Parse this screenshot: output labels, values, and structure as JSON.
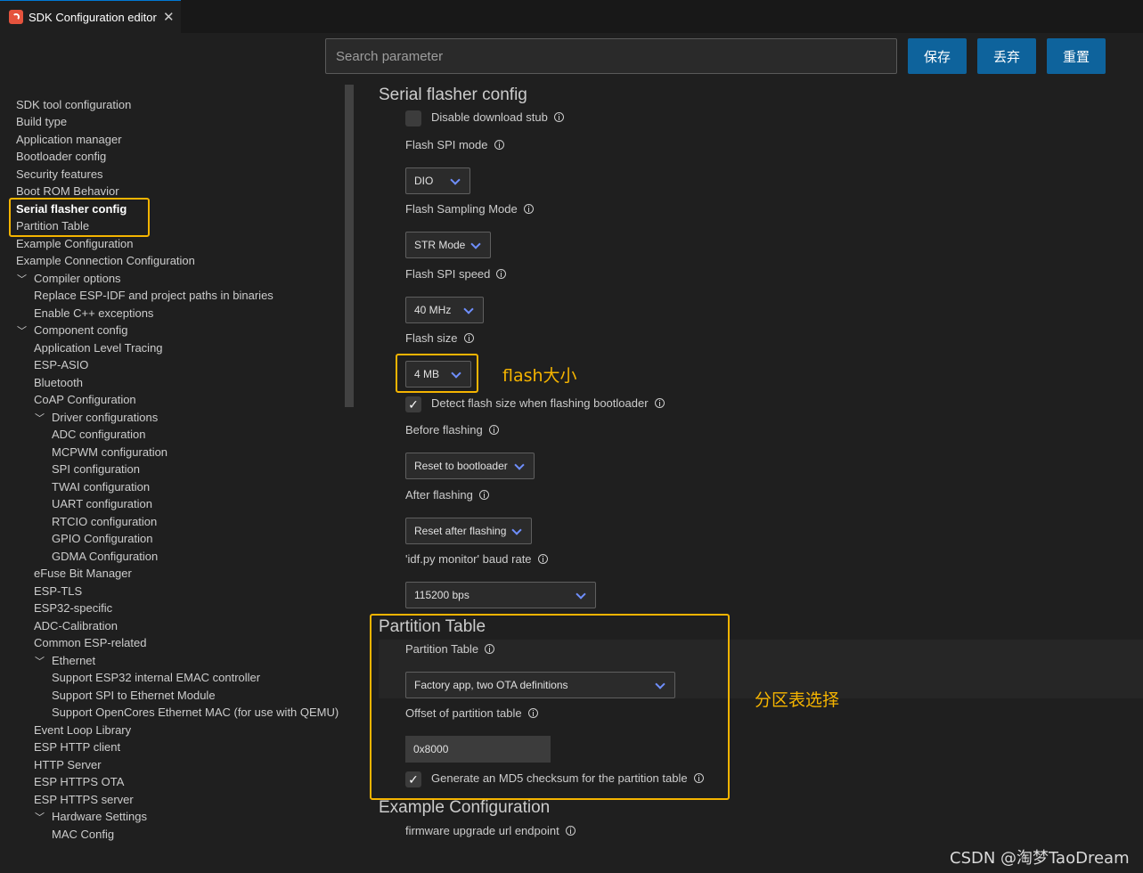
{
  "tab": {
    "title": "SDK Configuration editor",
    "close": "✕"
  },
  "toolbar": {
    "search_placeholder": "Search parameter",
    "save_label": "保存",
    "discard_label": "丢弃",
    "reset_label": "重置"
  },
  "sidebar": {
    "items": [
      "SDK tool configuration",
      "Build type",
      "Application manager",
      "Bootloader config",
      "Security features",
      "Boot ROM Behavior",
      "Serial flasher config",
      "Partition Table",
      "Example Configuration",
      "Example Connection Configuration",
      "Compiler options",
      "Replace ESP-IDF and project paths in binaries",
      "Enable C++ exceptions",
      "Component config",
      "Application Level Tracing",
      "ESP-ASIO",
      "Bluetooth",
      "CoAP Configuration",
      "Driver configurations",
      "ADC configuration",
      "MCPWM configuration",
      "SPI configuration",
      "TWAI configuration",
      "UART configuration",
      "RTCIO configuration",
      "GPIO Configuration",
      "GDMA Configuration",
      "eFuse Bit Manager",
      "ESP-TLS",
      "ESP32-specific",
      "ADC-Calibration",
      "Common ESP-related",
      "Ethernet",
      "Support ESP32 internal EMAC controller",
      "Support SPI to Ethernet Module",
      "Support OpenCores Ethernet MAC (for use with QEMU)",
      "Event Loop Library",
      "ESP HTTP client",
      "HTTP Server",
      "ESP HTTPS OTA",
      "ESP HTTPS server",
      "Hardware Settings",
      "MAC Config"
    ]
  },
  "serial_flasher": {
    "title": "Serial flasher config",
    "disable_stub": "Disable download stub",
    "spi_mode_label": "Flash SPI mode",
    "spi_mode_value": "DIO",
    "sampling_label": "Flash Sampling Mode",
    "sampling_value": "STR Mode",
    "spi_speed_label": "Flash SPI speed",
    "spi_speed_value": "40 MHz",
    "size_label": "Flash size",
    "size_value": "4 MB",
    "detect_size": "Detect flash size when flashing bootloader",
    "detect_size_check": "✓",
    "before_label": "Before flashing",
    "before_value": "Reset to bootloader",
    "after_label": "After flashing",
    "after_value": "Reset after flashing",
    "baud_label": "'idf.py monitor' baud rate",
    "baud_value": "115200 bps"
  },
  "partition": {
    "title": "Partition Table",
    "table_label": "Partition Table",
    "table_value": "Factory app, two OTA definitions",
    "offset_label": "Offset of partition table",
    "offset_value": "0x8000",
    "md5": "Generate an MD5 checksum for the partition table",
    "md5_check": "✓"
  },
  "example": {
    "title": "Example Configuration",
    "url_label": "firmware upgrade url endpoint"
  },
  "annotations": {
    "flash_size": "flash大小",
    "partition_select": "分区表选择"
  },
  "watermark": "CSDN @淘梦TaoDream",
  "colors": {
    "accent": "#0e639c",
    "annotation": "#f5b400",
    "background": "#1f1f1f"
  }
}
